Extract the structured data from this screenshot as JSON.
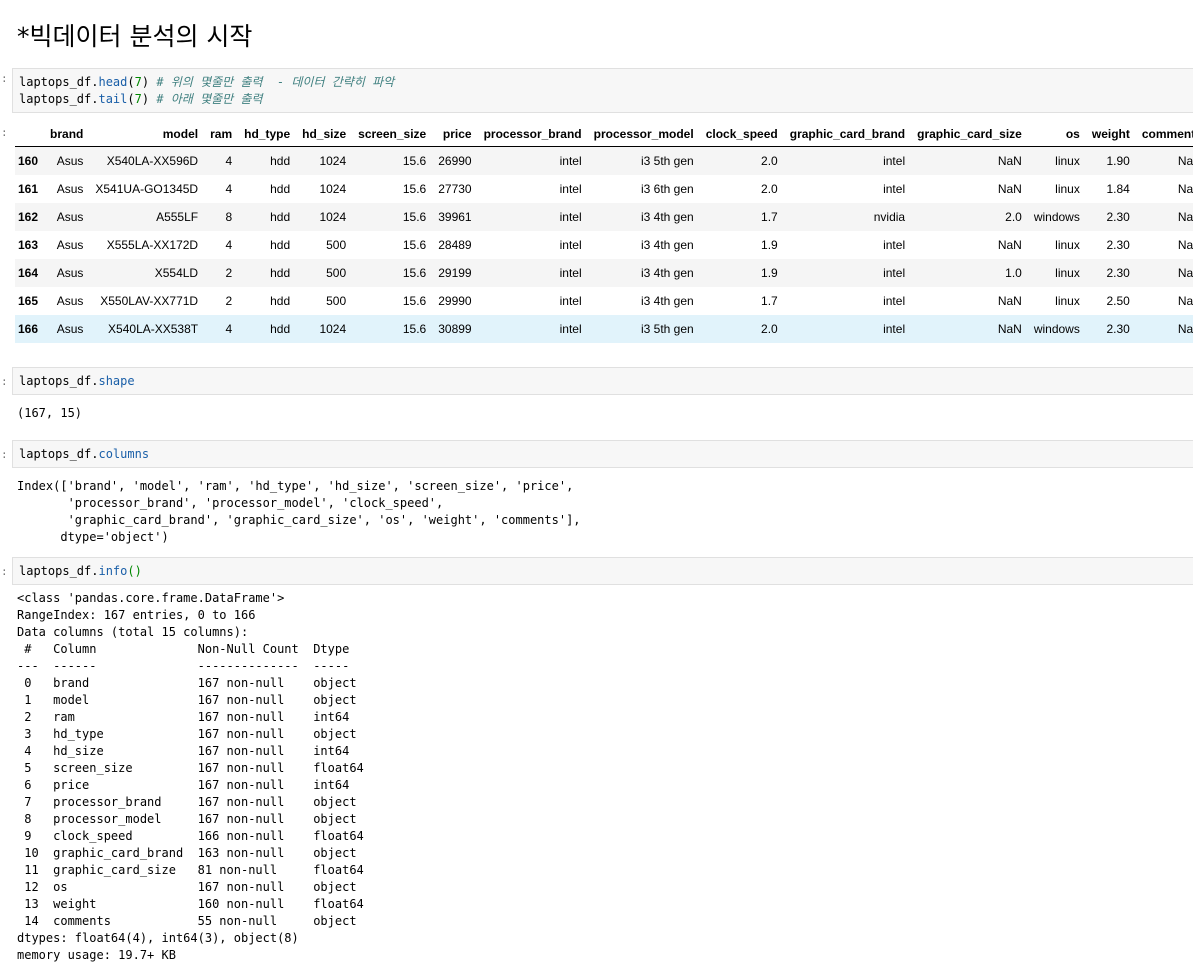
{
  "heading": "*빅데이터 분석의 시작",
  "cell1": {
    "line1_obj": "laptops_df.",
    "line1_method": "head",
    "line1_open": "(",
    "line1_num": "7",
    "line1_close": ")",
    "line1_comment": " # 위의 몇줄만 출력  - 데이터 간략히 파악",
    "line2_obj": "laptops_df.",
    "line2_method": "tail",
    "line2_open": "(",
    "line2_num": "7",
    "line2_close": ")",
    "line2_comment": " # 아래 몇줄만 출력"
  },
  "dataframe": {
    "columns": [
      "",
      "brand",
      "model",
      "ram",
      "hd_type",
      "hd_size",
      "screen_size",
      "price",
      "processor_brand",
      "processor_model",
      "clock_speed",
      "graphic_card_brand",
      "graphic_card_size",
      "os",
      "weight",
      "comments"
    ],
    "rows": [
      [
        "160",
        "Asus",
        "X540LA-XX596D",
        "4",
        "hdd",
        "1024",
        "15.6",
        "26990",
        "intel",
        "i3 5th gen",
        "2.0",
        "intel",
        "NaN",
        "linux",
        "1.90",
        "NaN"
      ],
      [
        "161",
        "Asus",
        "X541UA-GO1345D",
        "4",
        "hdd",
        "1024",
        "15.6",
        "27730",
        "intel",
        "i3 6th gen",
        "2.0",
        "intel",
        "NaN",
        "linux",
        "1.84",
        "NaN"
      ],
      [
        "162",
        "Asus",
        "A555LF",
        "8",
        "hdd",
        "1024",
        "15.6",
        "39961",
        "intel",
        "i3 4th gen",
        "1.7",
        "nvidia",
        "2.0",
        "windows",
        "2.30",
        "NaN"
      ],
      [
        "163",
        "Asus",
        "X555LA-XX172D",
        "4",
        "hdd",
        "500",
        "15.6",
        "28489",
        "intel",
        "i3 4th gen",
        "1.9",
        "intel",
        "NaN",
        "linux",
        "2.30",
        "NaN"
      ],
      [
        "164",
        "Asus",
        "X554LD",
        "2",
        "hdd",
        "500",
        "15.6",
        "29199",
        "intel",
        "i3 4th gen",
        "1.9",
        "intel",
        "1.0",
        "linux",
        "2.30",
        "NaN"
      ],
      [
        "165",
        "Asus",
        "X550LAV-XX771D",
        "2",
        "hdd",
        "500",
        "15.6",
        "29990",
        "intel",
        "i3 4th gen",
        "1.7",
        "intel",
        "NaN",
        "linux",
        "2.50",
        "NaN"
      ],
      [
        "166",
        "Asus",
        "X540LA-XX538T",
        "4",
        "hdd",
        "1024",
        "15.6",
        "30899",
        "intel",
        "i3 5th gen",
        "2.0",
        "intel",
        "NaN",
        "windows",
        "2.30",
        "NaN"
      ]
    ]
  },
  "cell2": {
    "obj": "laptops_df.",
    "attr": "shape"
  },
  "out2": "(167, 15)",
  "cell3": {
    "obj": "laptops_df.",
    "attr": "columns"
  },
  "out3": "Index(['brand', 'model', 'ram', 'hd_type', 'hd_size', 'screen_size', 'price',\n       'processor_brand', 'processor_model', 'clock_speed',\n       'graphic_card_brand', 'graphic_card_size', 'os', 'weight', 'comments'],\n      dtype='object')",
  "cell4": {
    "obj": "laptops_df.",
    "method": "info",
    "parens": "()"
  },
  "out4": "<class 'pandas.core.frame.DataFrame'>\nRangeIndex: 167 entries, 0 to 166\nData columns (total 15 columns):\n #   Column              Non-Null Count  Dtype  \n---  ------              --------------  -----  \n 0   brand               167 non-null    object \n 1   model               167 non-null    object \n 2   ram                 167 non-null    int64  \n 3   hd_type             167 non-null    object \n 4   hd_size             167 non-null    int64  \n 5   screen_size         167 non-null    float64\n 6   price               167 non-null    int64  \n 7   processor_brand     167 non-null    object \n 8   processor_model     167 non-null    object \n 9   clock_speed         166 non-null    float64\n 10  graphic_card_brand  163 non-null    object \n 11  graphic_card_size   81 non-null     float64\n 12  os                  167 non-null    object \n 13  weight              160 non-null    float64\n 14  comments            55 non-null     object \ndtypes: float64(4), int64(3), object(8)\nmemory usage: 19.7+ KB",
  "prompt_marker": ":"
}
